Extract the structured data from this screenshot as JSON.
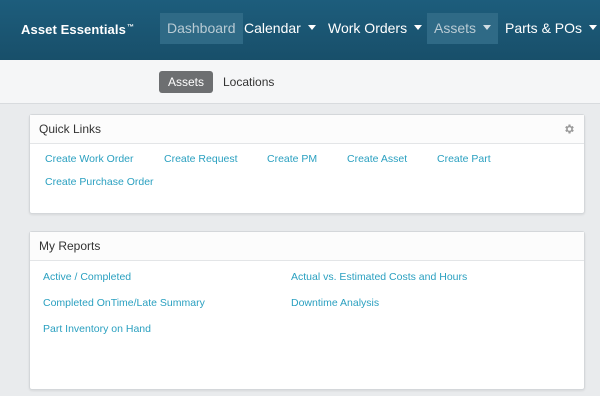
{
  "app": {
    "brand": "Asset Essentials",
    "brand_mark": "™"
  },
  "nav": {
    "items": [
      {
        "label": "Dashboard"
      },
      {
        "label": "Calendar"
      },
      {
        "label": "Work Orders"
      },
      {
        "label": "Assets"
      },
      {
        "label": "Parts & POs"
      }
    ]
  },
  "subnav": {
    "tabs": [
      {
        "label": "Assets"
      },
      {
        "label": "Locations"
      }
    ]
  },
  "quick_links": {
    "title": "Quick Links",
    "links": [
      {
        "label": "Create Work Order"
      },
      {
        "label": "Create Request"
      },
      {
        "label": "Create PM"
      },
      {
        "label": "Create Asset"
      },
      {
        "label": "Create Part"
      },
      {
        "label": "Create Purchase Order"
      }
    ]
  },
  "my_reports": {
    "title": "My Reports",
    "links": [
      {
        "label": "Active / Completed"
      },
      {
        "label": "Actual vs. Estimated Costs and Hours"
      },
      {
        "label": "Completed OnTime/Late Summary"
      },
      {
        "label": "Downtime Analysis"
      },
      {
        "label": "Part Inventory on Hand"
      }
    ]
  },
  "colors": {
    "topbar": "#1b5876",
    "link": "#2aa0c0",
    "active_subtab": "#6d6f71"
  },
  "icons": {
    "settings": "gear-icon",
    "dropdown": "caret-down-icon"
  }
}
